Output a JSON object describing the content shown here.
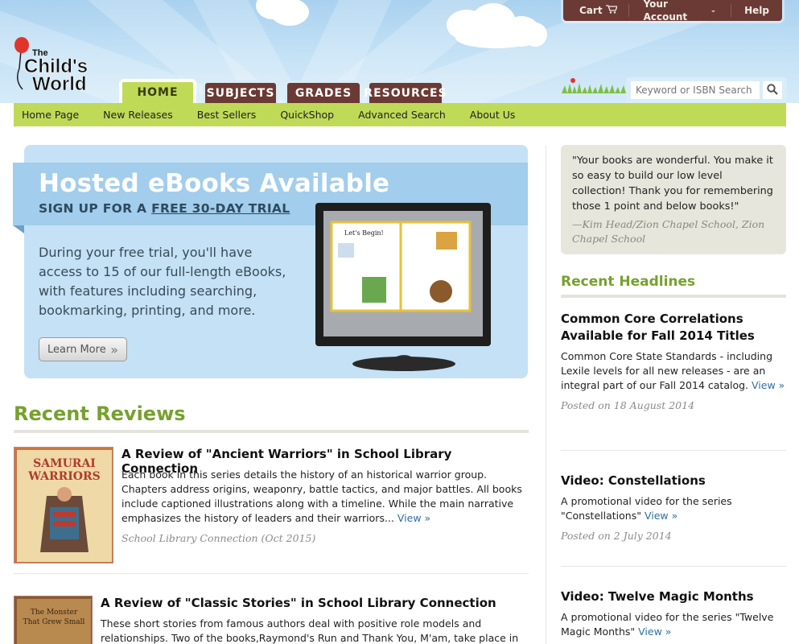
{
  "brand": {
    "name_small": "The",
    "name_large": "Child's",
    "name_large2": "World"
  },
  "topbar": {
    "cart": "Cart",
    "account": "Your Account",
    "help": "Help"
  },
  "tabs": [
    {
      "label": "HOME"
    },
    {
      "label": "SUBJECTS"
    },
    {
      "label": "GRADES"
    },
    {
      "label": "RESOURCES"
    }
  ],
  "search": {
    "placeholder": "Keyword or ISBN Search"
  },
  "subnav": [
    {
      "label": "Home Page"
    },
    {
      "label": "New Releases"
    },
    {
      "label": "Best Sellers"
    },
    {
      "label": "QuickShop"
    },
    {
      "label": "Advanced Search"
    },
    {
      "label": "About Us"
    }
  ],
  "hero": {
    "title": "Hosted eBooks Available",
    "sub_prefix": "SIGN UP FOR A ",
    "sub_link": "FREE 30-DAY TRIAL",
    "body": "During your free trial, you'll have access to 15 of our full-length eBooks, with features including searching, bookmarking, printing, and more.",
    "button": "Learn More",
    "button_icon": "»",
    "book_left_heading": "Let's Begin!"
  },
  "reviews": {
    "title": "Recent Reviews",
    "items": [
      {
        "title": "A Review of \"Ancient Warriors\" in School Library Connection",
        "body": "Each book in this series details the history of an historical warrior group. Chapters address origins, weaponry, battle tactics, and major battles. All books include captioned illustrations along with a timeline. While the main narrative emphasizes the history of leaders and their warriors...",
        "link": "View »",
        "source": "School Library Connection (Oct 2015)",
        "cover_title": "SAMURAI WARRIORS"
      },
      {
        "title": "A Review of \"Classic Stories\" in School Library Connection",
        "body": "These short stories from famous authors deal with positive role models and relationships. Two of the books,Raymond's Run and Thank You, M'am, take place in",
        "cover_title": "The Monster That Grew Small"
      }
    ]
  },
  "quote": {
    "text": "\"Your books are wonderful. You make it so easy to build our low level collection! Thank you for remembering those 1 point and below books!\"",
    "attribution": "—Kim Head/Zion Chapel School, Zion Chapel School"
  },
  "headlines": {
    "title": "Recent Headlines",
    "items": [
      {
        "title": "Common Core Correlations Available for Fall 2014 Titles",
        "body": "Common Core State Standards - including Lexile levels for all new releases - are an integral part of our Fall 2014 catalog.",
        "link": "View »",
        "date": "Posted on 18 August 2014"
      },
      {
        "title": "Video: Constellations",
        "body": "A promotional video for the series \"Constellations\"",
        "link": "View »",
        "date": "Posted on 2 July 2014"
      },
      {
        "title": "Video: Twelve Magic Months",
        "body": "A promotional video for the series \"Twelve Magic Months\"",
        "link": "View »"
      }
    ]
  },
  "colors": {
    "brown": "#6b3a34",
    "green": "#bfda57",
    "heading_green": "#76a12e",
    "sky": "#a9d1ef",
    "link": "#2f6ea0"
  }
}
